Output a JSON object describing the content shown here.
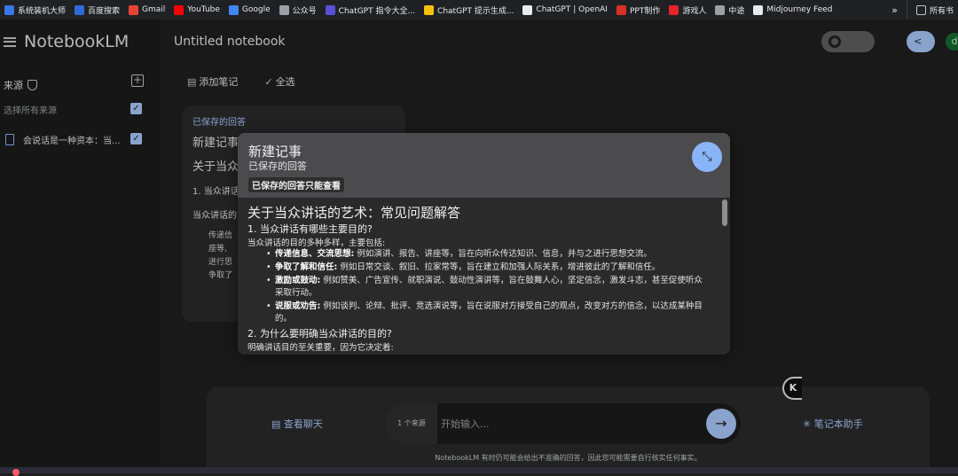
{
  "bookmarks": [
    {
      "label": "系统装机大师",
      "color": "#3b78e7"
    },
    {
      "label": "百度搜索",
      "color": "#2f6bd8"
    },
    {
      "label": "Gmail",
      "color": "#ea4335"
    },
    {
      "label": "YouTube",
      "color": "#ff0000"
    },
    {
      "label": "Google",
      "color": "#4285f4"
    },
    {
      "label": "公众号",
      "color": "#9aa0a6"
    },
    {
      "label": "ChatGPT 指令大全...",
      "color": "#5b4fd6"
    },
    {
      "label": "ChatGPT 提示生成...",
      "color": "#f4c20d"
    },
    {
      "label": "ChatGPT | OpenAI",
      "color": "#e8eaed"
    },
    {
      "label": "PPT制作",
      "color": "#d93025"
    },
    {
      "label": "游戏人",
      "color": "#e8232b"
    },
    {
      "label": "中途",
      "color": "#9aa0a6"
    },
    {
      "label": "Midjourney Feed",
      "color": "#e8eaed"
    }
  ],
  "bookmarks_more": "»",
  "bookmarks_folder_right": "所有书",
  "app": {
    "name": "NotebookLM",
    "notebook_title": "Untitled notebook",
    "avatar_letter": "d"
  },
  "sidebar": {
    "sources_label": "来源",
    "select_all_label": "选择所有来源",
    "source_item": "会说话是一种资本：当..."
  },
  "toolbar": {
    "add_note": "添加笔记",
    "select_all": "全选"
  },
  "note_card": {
    "saved_label": "已保存的回答",
    "title": "新建记事",
    "heading": "关于当众",
    "q1": "1. 当众讲话",
    "p1": "当众讲话的",
    "bullet_preview": [
      "传递信",
      "座等,",
      "进行思",
      "争取了"
    ]
  },
  "modal": {
    "title": "新建记事",
    "subtitle": "已保存的回答",
    "badge": "已保存的回答只能查看",
    "heading": "关于当众讲话的艺术：常见问题解答",
    "q1": "1. 当众讲话有哪些主要目的?",
    "q1_intro": "当众讲话的目的多种多样，主要包括:",
    "bullets": [
      {
        "term": "传递信息、交流思想:",
        "text": "例如演讲、报告、讲座等，旨在向听众传达知识、信息，并与之进行思想交流。"
      },
      {
        "term": "争取了解和信任:",
        "text": "例如日常交谈、叙旧、拉家常等，旨在建立和加强人际关系，增进彼此的了解和信任。"
      },
      {
        "term": "激励或鼓动:",
        "text": "例如赞美、广告宣传、就职演说、鼓动性演讲等，旨在鼓舞人心，坚定信念，激发斗志，甚至促使听众采取行动。"
      },
      {
        "term": "说服或劝告:",
        "text": "例如谈判、论辩、批评、竞选演说等，旨在说服对方接受自己的观点，改变对方的信念，以达成某种目的。"
      }
    ],
    "q2": "2. 为什么要明确当众讲话的目的?",
    "q2_intro": "明确讲话目的至关重要，因为它决定着:"
  },
  "chat": {
    "view_chat": "查看聊天",
    "source_count": "1 个来源",
    "placeholder": "开始输入...",
    "assistant": "笔记本助手",
    "disclaimer": "NotebookLM 有时仍可能会给出不准确的回答，因此您可能需要自行核实任何事实。"
  },
  "side_badge": "K"
}
